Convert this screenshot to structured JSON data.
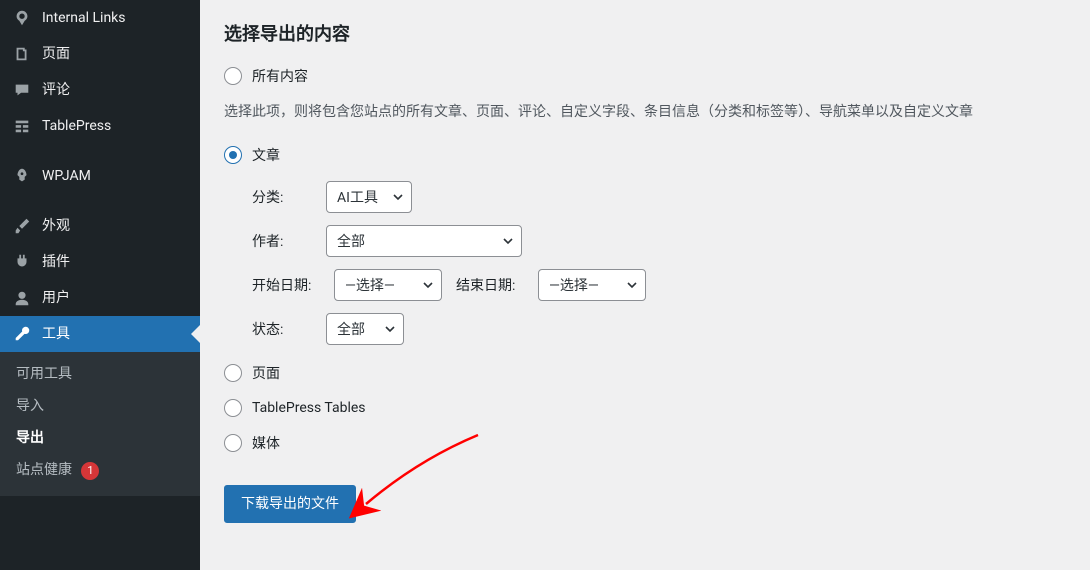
{
  "sidebar": {
    "items": [
      {
        "label": "Internal Links",
        "icon": "link-icon"
      },
      {
        "label": "页面",
        "icon": "pages-icon"
      },
      {
        "label": "评论",
        "icon": "comment-icon"
      },
      {
        "label": "TablePress",
        "icon": "table-icon"
      },
      {
        "label": "WPJAM",
        "icon": "rocket-icon"
      },
      {
        "label": "外观",
        "icon": "brush-icon"
      },
      {
        "label": "插件",
        "icon": "plugin-icon"
      },
      {
        "label": "用户",
        "icon": "users-icon"
      },
      {
        "label": "工具",
        "icon": "wrench-icon"
      }
    ],
    "submenu": {
      "items": [
        {
          "label": "可用工具"
        },
        {
          "label": "导入"
        },
        {
          "label": "导出",
          "current": true
        },
        {
          "label": "站点健康",
          "badge": "1"
        }
      ]
    }
  },
  "section_title": "选择导出的内容",
  "options": {
    "all": {
      "label": "所有内容",
      "desc": "选择此项，则将包含您站点的所有文章、页面、评论、自定义字段、条目信息（分类和标签等）、导航菜单以及自定义文章"
    },
    "posts": {
      "label": "文章"
    },
    "pages": {
      "label": "页面"
    },
    "tablepress": {
      "label": "TablePress Tables"
    },
    "media": {
      "label": "媒体"
    }
  },
  "filters": {
    "category": {
      "label": "分类:",
      "value": "AI工具"
    },
    "author": {
      "label": "作者:",
      "value": "全部"
    },
    "date_start": {
      "label": "开始日期:",
      "value": "—选择—"
    },
    "date_end": {
      "label": "结束日期:",
      "value": "—选择—"
    },
    "status": {
      "label": "状态:",
      "value": "全部"
    }
  },
  "download_button": "下载导出的文件"
}
